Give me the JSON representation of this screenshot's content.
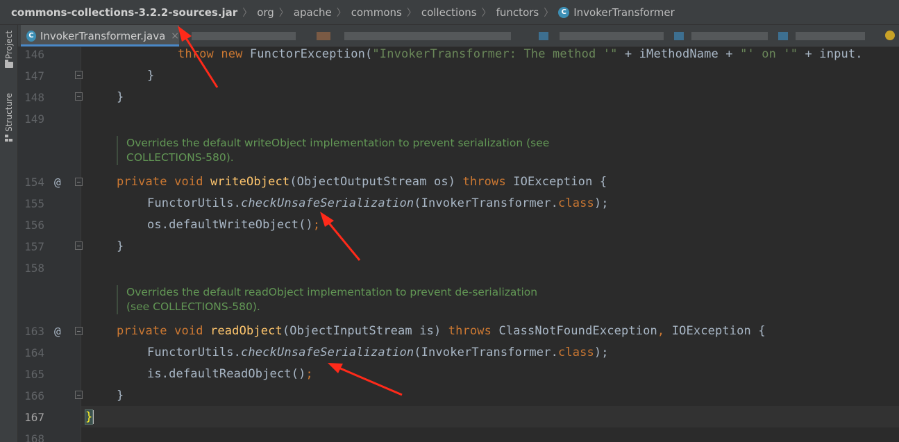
{
  "breadcrumb": {
    "items": [
      "commons-collections-3.2.2-sources.jar",
      "org",
      "apache",
      "commons",
      "collections",
      "functors",
      "InvokerTransformer"
    ],
    "separator": "〉",
    "class_icon": "C"
  },
  "toolstrip": {
    "project_label": "Project",
    "structure_label": "Structure"
  },
  "tabs": {
    "active_label": "InvokerTransformer.java",
    "active_icon": "C",
    "close_glyph": "×"
  },
  "editor": {
    "line_numbers": {
      "l146": "146",
      "l147": "147",
      "l148": "148",
      "l149": "149",
      "l154": "154",
      "l155": "155",
      "l156": "156",
      "l157": "157",
      "l158": "158",
      "l163": "163",
      "l164": "164",
      "l165": "165",
      "l166": "166",
      "l167": "167",
      "l168": "168"
    },
    "override_marker": "@",
    "doc1_line1": "Overrides the default writeObject implementation to prevent serialization (see",
    "doc1_line2": "COLLECTIONS-580).",
    "doc2_line1": "Overrides the default readObject implementation to prevent de-serialization",
    "doc2_line2": "(see COLLECTIONS-580).",
    "code": {
      "l146_throw": "throw",
      "l146_new": "new",
      "l146_rest": "FunctorException(",
      "l146_str": "\"InvokerTransformer: The method '\"",
      "l146_plus": " + iMethodName + ",
      "l146_str2": "\"' on '\"",
      "l146_tail": " + input.",
      "close_brace": "}",
      "private": "private",
      "void": "void",
      "throws": "throws",
      "writeObject": "writeObject",
      "write_params": "(ObjectOutputStream os) ",
      "write_ex": "IOException {",
      "functorUtils": "FunctorUtils.",
      "checkUnsafe": "checkUnsafeSerialization",
      "invoker_arg": "(InvokerTransformer.",
      "class_kw": "class",
      "paren_semi": ");",
      "os_default": "os.defaultWriteObject()",
      "semi": ";",
      "readObject": "readObject",
      "read_params": "(ObjectInputStream is) ",
      "read_ex1": "ClassNotFoundException",
      "comma": ", ",
      "read_ex2": "IOException {",
      "is_default": "is.defaultReadObject()"
    }
  },
  "colors": {
    "keyword": "#cc7832",
    "method": "#ffc66d",
    "comment": "#629755",
    "annotation_arrow": "#ff2a1a"
  }
}
